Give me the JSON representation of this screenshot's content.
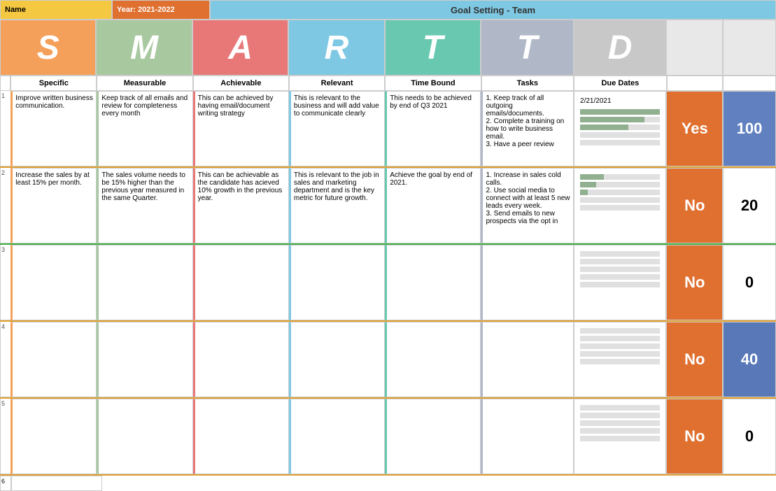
{
  "title": {
    "name_label": "Name",
    "year_label": "Year: 2021-2022",
    "main_title": "Goal Setting - Team"
  },
  "smart_letters": {
    "s": "S",
    "m": "M",
    "a": "A",
    "r": "R",
    "t1": "T",
    "t2": "T",
    "d": "D"
  },
  "col_headers": {
    "specific": "Specific",
    "measurable": "Measurable",
    "achievable": "Achievable",
    "relevant": "Relevant",
    "timebound": "Time Bound",
    "tasks": "Tasks",
    "due_dates": "Due Dates"
  },
  "rows": [
    {
      "num": "1",
      "specific": "Improve written business communication.",
      "measurable": "Keep track of all emails and review for completeness every month",
      "achievable": "This can be achieved by having email/document writing strategy",
      "relevant": "This is relevant to the business and will add value to communicate clearly",
      "timebound": "This needs to be achieved by end of Q3 2021",
      "tasks": "1. Keep track of all outgoing emails/documents.\n2. Complete a training on how to write business email.\n3. Have a peer review",
      "due_date": "2/21/2021",
      "progress": [
        100,
        80,
        60
      ],
      "yes_no": "Yes",
      "number": "100",
      "num_class": "num-blue"
    },
    {
      "num": "2",
      "specific": "Increase the sales by at least 15% per month.",
      "measurable": "The sales volume needs to be 15% higher than the previous year measured in the same Quarter.",
      "achievable": "This can be achievable as the candidate has acieved 10% growth in the previous year.",
      "relevant": "This is relevant to the job in sales and marketing department and is the key metric for future growth.",
      "timebound": "Achieve the goal by end of 2021.",
      "tasks": "1. Increase in sales cold calls.\n2. Use social media to connect with at least 5 new leads every week.\n3. Send emails to new prospects via the opt in",
      "due_date": "",
      "progress": [
        30,
        20,
        10
      ],
      "yes_no": "No",
      "number": "20",
      "num_class": "num-white"
    },
    {
      "num": "3",
      "specific": "",
      "measurable": "",
      "achievable": "",
      "relevant": "",
      "timebound": "",
      "tasks": "",
      "due_date": "",
      "progress": [
        0,
        0,
        0,
        0,
        0
      ],
      "yes_no": "No",
      "number": "0",
      "num_class": "num-white"
    },
    {
      "num": "4",
      "specific": "",
      "measurable": "",
      "achievable": "",
      "relevant": "",
      "timebound": "",
      "tasks": "",
      "due_date": "",
      "progress": [
        0,
        0,
        0,
        0,
        0
      ],
      "yes_no": "No",
      "number": "40",
      "num_class": "num-blue2"
    },
    {
      "num": "5",
      "specific": "",
      "measurable": "",
      "achievable": "",
      "relevant": "",
      "timebound": "",
      "tasks": "",
      "due_date": "",
      "progress": [
        0,
        0,
        0,
        0,
        0
      ],
      "yes_no": "No",
      "number": "0",
      "num_class": "num-white"
    }
  ]
}
